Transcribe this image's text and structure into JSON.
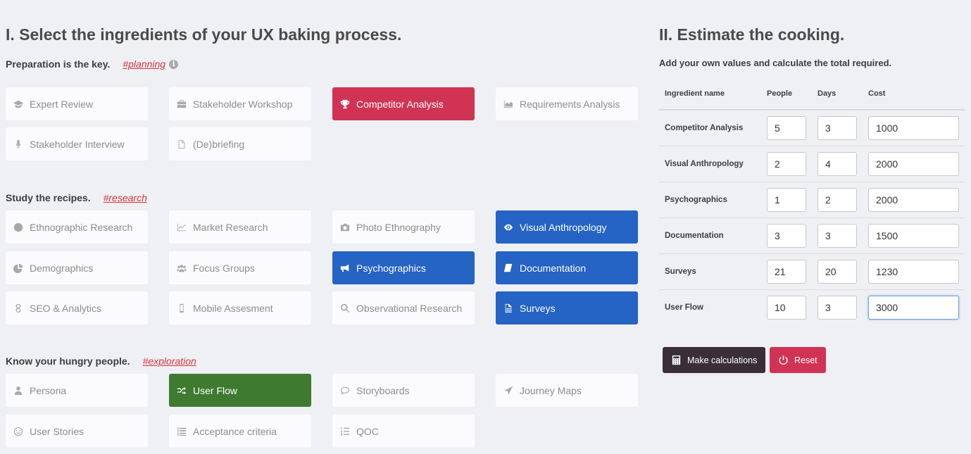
{
  "left": {
    "title": "I. Select the ingredients of your UX baking process.",
    "sections": [
      {
        "heading": "Preparation is the key.",
        "tag": "#planning",
        "info_icon": "info-circle-icon",
        "items": [
          {
            "label": "Expert Review",
            "icon": "graduation-cap-icon",
            "state": "default"
          },
          {
            "label": "Stakeholder Workshop",
            "icon": "briefcase-icon",
            "state": "default"
          },
          {
            "label": "Competitor Analysis",
            "icon": "trophy-icon",
            "state": "selected-red"
          },
          {
            "label": "Requirements Analysis",
            "icon": "area-chart-icon",
            "state": "default"
          },
          {
            "label": "Stakeholder Interview",
            "icon": "microphone-icon",
            "state": "default"
          },
          {
            "label": "(De)briefing",
            "icon": "file-icon",
            "state": "default"
          }
        ]
      },
      {
        "heading": "Study the recipes.",
        "tag": "#research",
        "items": [
          {
            "label": "Ethnographic Research",
            "icon": "globe-icon",
            "state": "default"
          },
          {
            "label": "Market Research",
            "icon": "line-chart-icon",
            "state": "default"
          },
          {
            "label": "Photo Ethnography",
            "icon": "camera-icon",
            "state": "default"
          },
          {
            "label": "Visual Anthropology",
            "icon": "eye-icon",
            "state": "selected-blue"
          },
          {
            "label": "Demographics",
            "icon": "pie-chart-icon",
            "state": "default"
          },
          {
            "label": "Focus Groups",
            "icon": "users-icon",
            "state": "default"
          },
          {
            "label": "Psychographics",
            "icon": "bullhorn-icon",
            "state": "selected-blue"
          },
          {
            "label": "Documentation",
            "icon": "book-icon",
            "state": "selected-blue"
          },
          {
            "label": "SEO & Analytics",
            "icon": "google-icon",
            "state": "default"
          },
          {
            "label": "Mobile Assesment",
            "icon": "mobile-icon",
            "state": "default"
          },
          {
            "label": "Observational Research",
            "icon": "search-icon",
            "state": "default"
          },
          {
            "label": "Surveys",
            "icon": "file-text-icon",
            "state": "selected-blue"
          }
        ]
      },
      {
        "heading": "Know your hungry people.",
        "tag": "#exploration",
        "items": [
          {
            "label": "Persona",
            "icon": "user-icon",
            "state": "default"
          },
          {
            "label": "User Flow",
            "icon": "random-icon",
            "state": "selected-green"
          },
          {
            "label": "Storyboards",
            "icon": "comment-icon",
            "state": "default"
          },
          {
            "label": "Journey Maps",
            "icon": "location-arrow-icon",
            "state": "default"
          },
          {
            "label": "User Stories",
            "icon": "smile-icon",
            "state": "default"
          },
          {
            "label": "Acceptance criteria",
            "icon": "list-icon",
            "state": "default"
          },
          {
            "label": "QOC",
            "icon": "ordered-list-icon",
            "state": "default"
          }
        ]
      }
    ]
  },
  "right": {
    "title": "II. Estimate the cooking.",
    "subtitle": "Add your own values and calculate the total required.",
    "table": {
      "headers": [
        "Ingredient name",
        "People",
        "Days",
        "Cost"
      ],
      "rows": [
        {
          "name": "Competitor Analysis",
          "people": "5",
          "days": "3",
          "cost": "1000"
        },
        {
          "name": "Visual Anthropology",
          "people": "2",
          "days": "4",
          "cost": "2000"
        },
        {
          "name": "Psychographics",
          "people": "1",
          "days": "2",
          "cost": "2000"
        },
        {
          "name": "Documentation",
          "people": "3",
          "days": "3",
          "cost": "1500"
        },
        {
          "name": "Surveys",
          "people": "21",
          "days": "20",
          "cost": "1230"
        },
        {
          "name": "User Flow",
          "people": "10",
          "days": "3",
          "cost": "3000"
        }
      ]
    },
    "buttons": {
      "calculate_label": "Make calculations",
      "calculate_icon": "calculator-icon",
      "reset_label": "Reset",
      "reset_icon": "power-icon"
    }
  },
  "colors": {
    "background": "#eff0f4",
    "red": "#d13354",
    "blue": "#2563c4",
    "green": "#3e7a30",
    "dark_button": "#3a2f37",
    "tag": "#d7343f"
  }
}
